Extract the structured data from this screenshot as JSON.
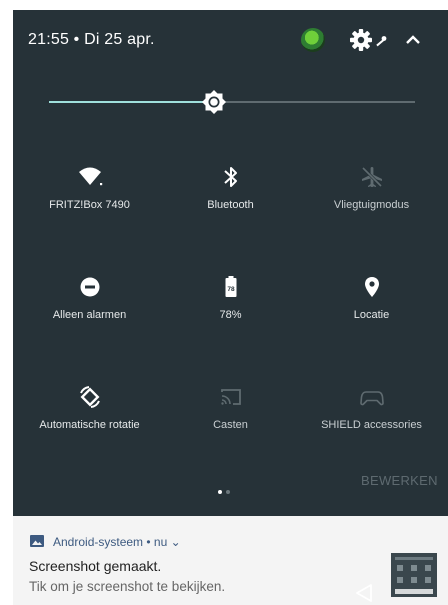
{
  "status": {
    "time_date": "21:55 • Di 25 apr."
  },
  "brightness": {
    "level_percent": 45
  },
  "tiles": [
    {
      "name": "wifi",
      "label": "FRITZ!Box 7490",
      "icon": "wifi-icon",
      "state": "on"
    },
    {
      "name": "bluetooth",
      "label": "Bluetooth",
      "icon": "bluetooth-icon",
      "state": "on"
    },
    {
      "name": "airplane",
      "label": "Vliegtuigmodus",
      "icon": "airplane-icon",
      "state": "off"
    },
    {
      "name": "alarms",
      "label": "Alleen alarmen",
      "icon": "do-not-disturb-icon",
      "state": "on"
    },
    {
      "name": "battery",
      "label": "78%",
      "icon": "battery-icon",
      "battery_level": "78",
      "state": "on"
    },
    {
      "name": "location",
      "label": "Locatie",
      "icon": "location-pin-icon",
      "state": "on"
    },
    {
      "name": "rotation",
      "label": "Automatische rotatie",
      "icon": "auto-rotate-icon",
      "state": "on"
    },
    {
      "name": "cast",
      "label": "Casten",
      "icon": "cast-icon",
      "state": "off"
    },
    {
      "name": "shield",
      "label": "SHIELD accessories",
      "icon": "gamepad-icon",
      "state": "off"
    }
  ],
  "pager": {
    "current_page": 1,
    "page_count": 2
  },
  "edit_label": "BEWERKEN",
  "notification": {
    "header": "Android-systeem • nu ⌄",
    "title": "Screenshot gemaakt.",
    "text": "Tik om je screenshot te bekijken."
  },
  "colors": {
    "panel": "#263238",
    "accent": "#9fe0dc",
    "text": "#ffffff",
    "dim": "#5f6b70",
    "notification_bg": "#f4f4f4",
    "notification_header": "#3d5a80"
  }
}
